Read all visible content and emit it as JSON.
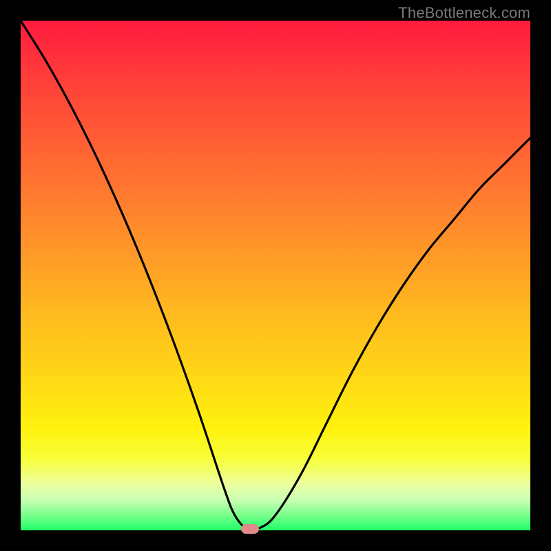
{
  "watermark": "TheBottleneck.com",
  "colors": {
    "frame": "#000000",
    "curve": "#000000",
    "marker": "#e08a8a",
    "gradient_top": "#ff1a3d",
    "gradient_bottom": "#1eff66",
    "watermark": "#7a7a7a"
  },
  "chart_data": {
    "type": "line",
    "title": "",
    "xlabel": "",
    "ylabel": "",
    "xlim": [
      0,
      100
    ],
    "ylim": [
      0,
      100
    ],
    "grid": false,
    "legend": false,
    "series": [
      {
        "name": "bottleneck-curve",
        "x": [
          0,
          5,
          10,
          15,
          20,
          25,
          30,
          35,
          40,
          42,
          44,
          45,
          47,
          50,
          55,
          60,
          65,
          70,
          75,
          80,
          85,
          90,
          95,
          100
        ],
        "values": [
          100,
          92,
          83,
          73,
          62,
          50,
          37,
          23,
          8,
          3,
          0.5,
          0.5,
          0.5,
          3,
          11,
          21,
          31,
          40,
          48,
          55,
          61,
          67,
          72,
          77
        ]
      }
    ],
    "annotations": [
      {
        "name": "optimal-marker",
        "x": 45,
        "y": 0.3,
        "shape": "pill"
      }
    ],
    "notes": "V-shaped bottleneck curve over a red-to-green vertical gradient. x units are arbitrary (0-100) since no axis labels are shown; y likewise 0-100 with 0 at bottom. Minimum (optimal point) around x≈45. Left branch starts at top-left corner, right branch exits near (100, 77)."
  }
}
